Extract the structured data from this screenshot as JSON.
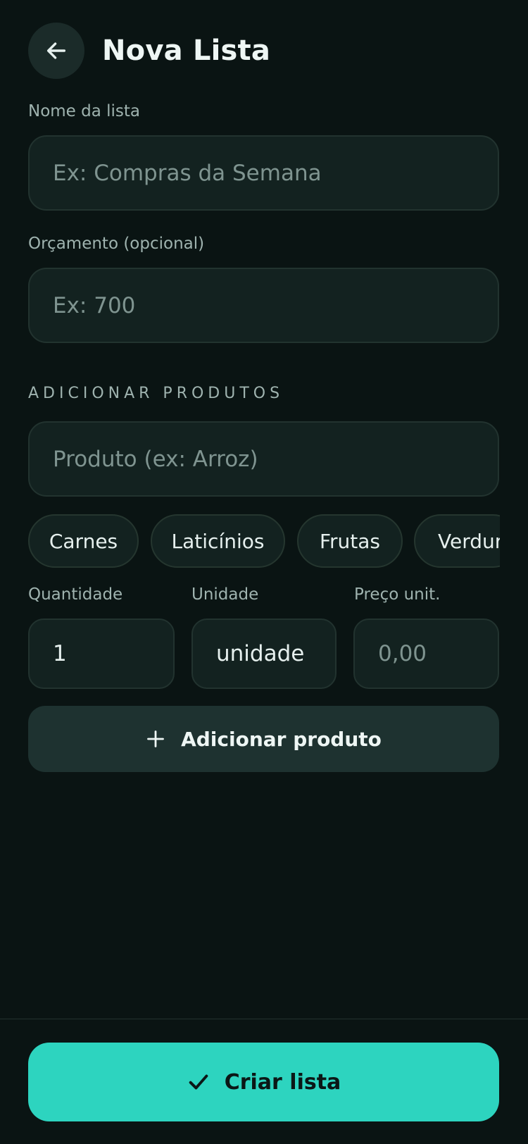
{
  "header": {
    "title": "Nova Lista",
    "back_icon": "arrow-left-icon"
  },
  "list_name": {
    "label": "Nome da lista",
    "placeholder": "Ex: Compras da Semana",
    "value": ""
  },
  "budget": {
    "label": "Orçamento (opcional)",
    "placeholder": "Ex: 700",
    "value": ""
  },
  "add_products": {
    "section_label": "ADICIONAR PRODUTOS",
    "product_placeholder": "Produto (ex: Arroz)",
    "categories": [
      "Carnes",
      "Laticínios",
      "Frutas",
      "Verdur"
    ],
    "quantity_label": "Quantidade",
    "quantity_value": "1",
    "unit_label": "Unidade",
    "unit_value": "unidade",
    "price_label": "Preço unit.",
    "price_placeholder": "0,00",
    "add_button_label": "Adicionar produto",
    "add_icon": "plus-icon"
  },
  "footer": {
    "create_button_label": "Criar lista",
    "create_icon": "check-icon"
  },
  "colors": {
    "background": "#0a1413",
    "field": "#132220",
    "accent": "#2dd4bf",
    "secondary_button": "#1e3230"
  }
}
